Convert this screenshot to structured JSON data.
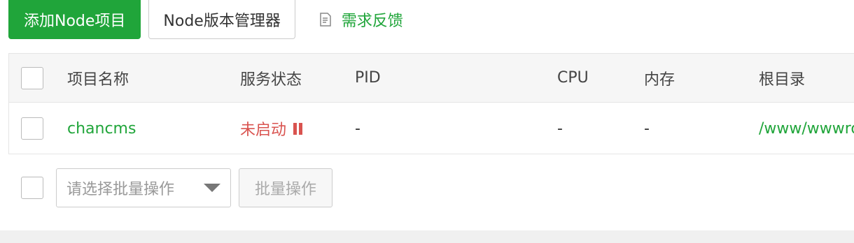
{
  "toolbar": {
    "add_label": "添加Node项目",
    "manager_label": "Node版本管理器",
    "feedback_label": "需求反馈",
    "feedback_icon": "edit-note-icon"
  },
  "table": {
    "headers": {
      "name": "项目名称",
      "status": "服务状态",
      "pid": "PID",
      "cpu": "CPU",
      "memory": "内存",
      "root": "根目录"
    },
    "rows": [
      {
        "name": "chancms",
        "status": "未启动",
        "status_icon": "pause-icon",
        "pid": "-",
        "cpu": "-",
        "memory": "-",
        "root": "/www/wwwro"
      }
    ]
  },
  "batch": {
    "select_placeholder": "请选择批量操作",
    "button_label": "批量操作"
  },
  "colors": {
    "primary": "#20a53a",
    "danger": "#d9534f",
    "header_bg": "#f6f6f6"
  }
}
